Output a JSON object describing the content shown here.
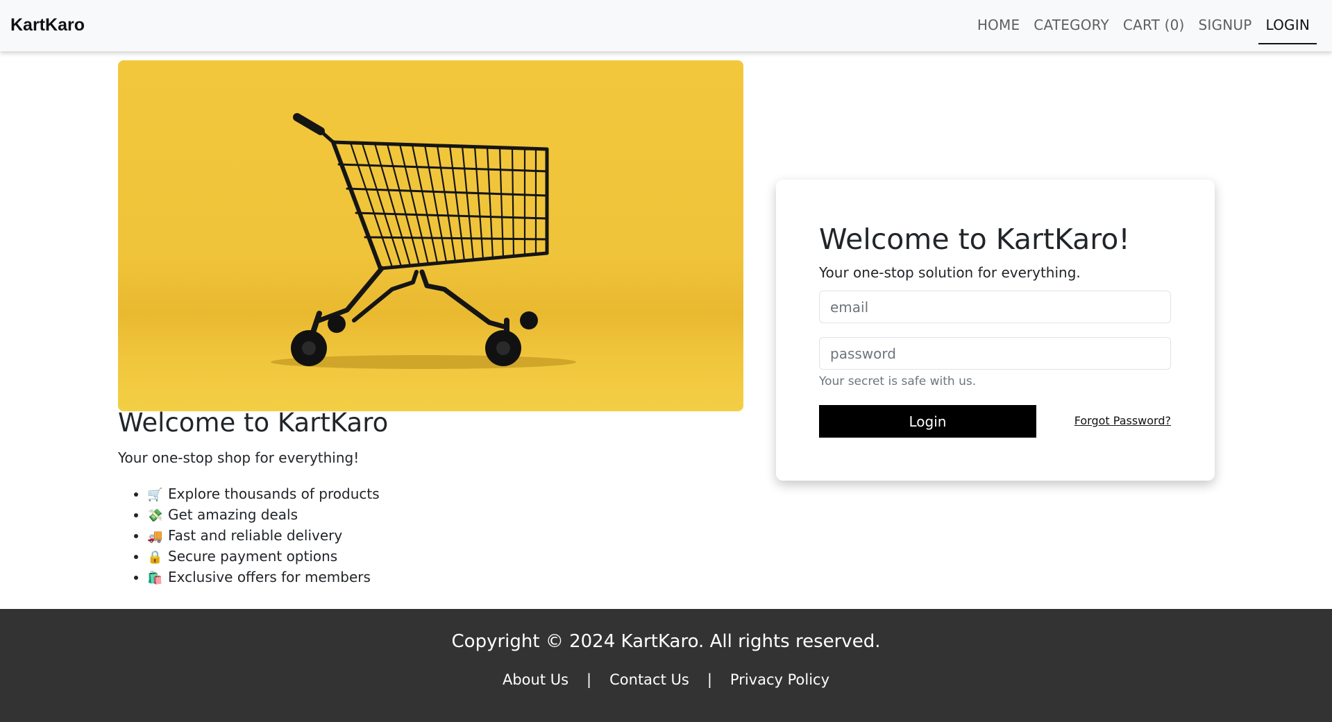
{
  "navbar": {
    "brand": "KartKaro",
    "links": [
      {
        "label": "HOME"
      },
      {
        "label": "CATEGORY"
      },
      {
        "label": "CART (0)"
      },
      {
        "label": "SIGNUP"
      },
      {
        "label": "LOGIN",
        "active": true
      }
    ]
  },
  "hero": {
    "image_icon": "shopping-cart-image",
    "title": "Welcome to KartKaro",
    "subtitle": "Your one-stop shop for everything!",
    "features": [
      {
        "emoji": "🛒",
        "text": "Explore thousands of products"
      },
      {
        "emoji": "💸",
        "text": "Get amazing deals"
      },
      {
        "emoji": "🚚",
        "text": "Fast and reliable delivery"
      },
      {
        "emoji": "🔒",
        "text": "Secure payment options"
      },
      {
        "emoji": "🛍️",
        "text": "Exclusive offers for members"
      }
    ]
  },
  "login": {
    "title": "Welcome to KartKaro!",
    "subtitle": "Your one-stop solution for everything.",
    "email_value": "",
    "email_placeholder": "email",
    "password_value": "",
    "password_placeholder": "password",
    "hint": "Your secret is safe with us.",
    "button_label": "Login",
    "forgot_label": "Forgot Password?"
  },
  "footer": {
    "copyright": "Copyright © 2024 KartKaro. All rights reserved.",
    "links": [
      "About Us",
      "Contact Us",
      "Privacy Policy"
    ],
    "separator": "|"
  },
  "colors": {
    "navbar_bg": "#f8f9fa",
    "hero_bg": "#f2c73c",
    "button_bg": "#000000",
    "footer_bg": "#333333"
  }
}
